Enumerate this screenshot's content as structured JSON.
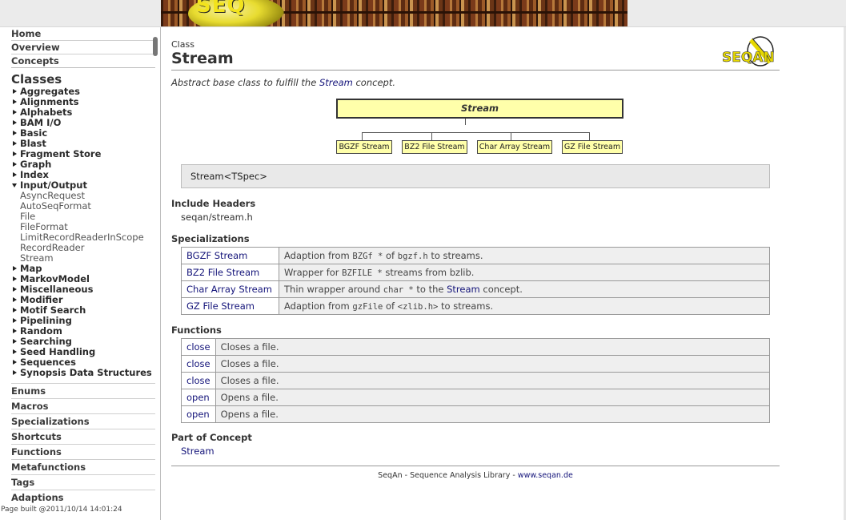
{
  "banner": {
    "logo_text": "SEQ"
  },
  "sidebar": {
    "nav": [
      "Home",
      "Overview",
      "Concepts"
    ],
    "classes_heading": "Classes",
    "tree": [
      {
        "label": "Aggregates",
        "expanded": false
      },
      {
        "label": "Alignments",
        "expanded": false
      },
      {
        "label": "Alphabets",
        "expanded": false
      },
      {
        "label": "BAM I/O",
        "expanded": false
      },
      {
        "label": "Basic",
        "expanded": false
      },
      {
        "label": "Blast",
        "expanded": false
      },
      {
        "label": "Fragment Store",
        "expanded": false
      },
      {
        "label": "Graph",
        "expanded": false
      },
      {
        "label": "Index",
        "expanded": false
      },
      {
        "label": "Input/Output",
        "expanded": true
      }
    ],
    "io_children": [
      "AsyncRequest",
      "AutoSeqFormat",
      "File",
      "FileFormat",
      "LimitRecordReaderInScope",
      "RecordReader",
      "Stream"
    ],
    "tree_after": [
      "Map",
      "MarkovModel",
      "Miscellaneous",
      "Modifier",
      "Motif Search",
      "Pipelining",
      "Random",
      "Searching",
      "Seed Handling",
      "Sequences",
      "Synopsis Data Structures"
    ],
    "sections": [
      "Enums",
      "Macros",
      "Specializations",
      "Shortcuts",
      "Functions",
      "Metafunctions",
      "Tags",
      "Adaptions"
    ],
    "page_built": "Page built @2011/10/14 14:01:24"
  },
  "page": {
    "kind": "Class",
    "title": "Stream",
    "logo": "SEQAN",
    "summary_prefix": "Abstract base class to fulfill the ",
    "summary_link": "Stream",
    "summary_suffix": " concept.",
    "diagram": {
      "root": "Stream",
      "children": [
        "BGZF Stream",
        "BZ2 File Stream",
        "Char Array Stream",
        "GZ File Stream"
      ]
    },
    "signature": "Stream<TSpec>",
    "include_heading": "Include Headers",
    "include_value": "seqan/stream.h",
    "specializations_heading": "Specializations",
    "specializations": [
      {
        "name": "BGZF Stream",
        "pre": "Adaption from ",
        "code1": "BZGf *",
        "mid": " of ",
        "code2": "bgzf.h",
        "post": " to streams."
      },
      {
        "name": "BZ2 File Stream",
        "pre": "Wrapper for ",
        "code1": "BZFILE *",
        "mid": " streams from bzlib.",
        "code2": "",
        "post": ""
      },
      {
        "name": "Char Array Stream",
        "pre": "Thin wrapper around ",
        "code1": "char *",
        "mid": " to the ",
        "link": "Stream",
        "post": " concept."
      },
      {
        "name": "GZ File Stream",
        "pre": "Adaption from ",
        "code1": "gzFile",
        "mid": " of ",
        "code2": "<zlib.h>",
        "post": " to streams."
      }
    ],
    "functions_heading": "Functions",
    "functions": [
      {
        "name": "close",
        "desc": "Closes a file."
      },
      {
        "name": "close",
        "desc": "Closes a file."
      },
      {
        "name": "close",
        "desc": "Closes a file."
      },
      {
        "name": "open",
        "desc": "Opens a file."
      },
      {
        "name": "open",
        "desc": "Opens a file."
      }
    ],
    "concept_heading": "Part of Concept",
    "concept_value": "Stream",
    "footer_text": "SeqAn - Sequence Analysis Library - ",
    "footer_link": "www.seqan.de"
  }
}
